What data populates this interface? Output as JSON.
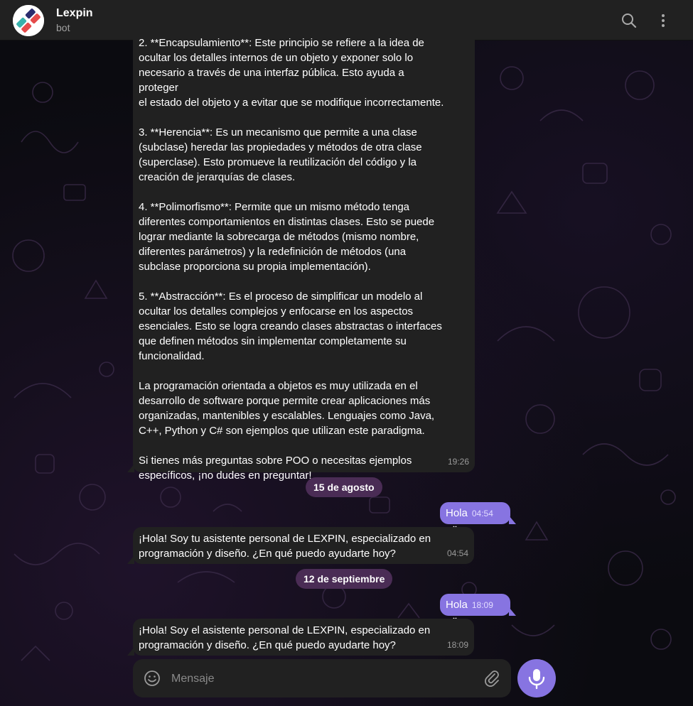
{
  "header": {
    "title": "Lexpin",
    "subtitle": "bot"
  },
  "messages": {
    "long_bot": {
      "text": "2. **Encapsulamiento**: Este principio se refiere a la idea de\nocultar los detalles internos de un objeto y exponer solo lo\nnecesario a través de una interfaz pública. Esto ayuda a proteger\nel estado del objeto y a evitar que se modifique incorrectamente.\n\n3. **Herencia**: Es un mecanismo que permite a una clase\n(subclase) heredar las propiedades y métodos de otra clase\n(superclase). Esto promueve la reutilización del código y la\ncreación de jerarquías de clases.\n\n4. **Polimorfismo**: Permite que un mismo método tenga\ndiferentes comportamientos en distintas clases. Esto se puede\nlograr mediante la sobrecarga de métodos (mismo nombre,\ndiferentes parámetros) y la redefinición de métodos (una\nsubclase proporciona su propia implementación).\n\n5. **Abstracción**: Es el proceso de simplificar un modelo al\nocultar los detalles complejos y enfocarse en los aspectos\nesenciales. Esto se logra creando clases abstractas o interfaces\nque definen métodos sin implementar completamente su\nfuncionalidad.\n\nLa programación orientada a objetos es muy utilizada en el\ndesarrollo de software porque permite crear aplicaciones más\norganizadas, mantenibles y escalables. Lenguajes como Java,\nC++, Python y C# son ejemplos que utilizan este paradigma.\n\nSi tienes más preguntas sobre POO o necesitas ejemplos\nespecíficos, ¡no dudes en preguntar!",
      "time": "19:26"
    },
    "date1": "15 de agosto",
    "user1": {
      "text": "Hola",
      "time": "04:54"
    },
    "bot1": {
      "text": "¡Hola! Soy tu asistente personal de LEXPIN, especializado en\nprogramación y diseño. ¿En qué puedo ayudarte hoy?",
      "time": "04:54"
    },
    "date2": "12 de septiembre",
    "user2": {
      "text": "Hola",
      "time": "18:09"
    },
    "bot2": {
      "text": "¡Hola! Soy el asistente personal de LEXPIN, especializado en\nprogramación y diseño. ¿En qué puedo ayudarte hoy?",
      "time": "18:09"
    }
  },
  "composer": {
    "placeholder": "Mensaje"
  },
  "colors": {
    "accent": "#8774e1",
    "bubble_in": "#212121",
    "date_pill": "#4a2c55"
  }
}
